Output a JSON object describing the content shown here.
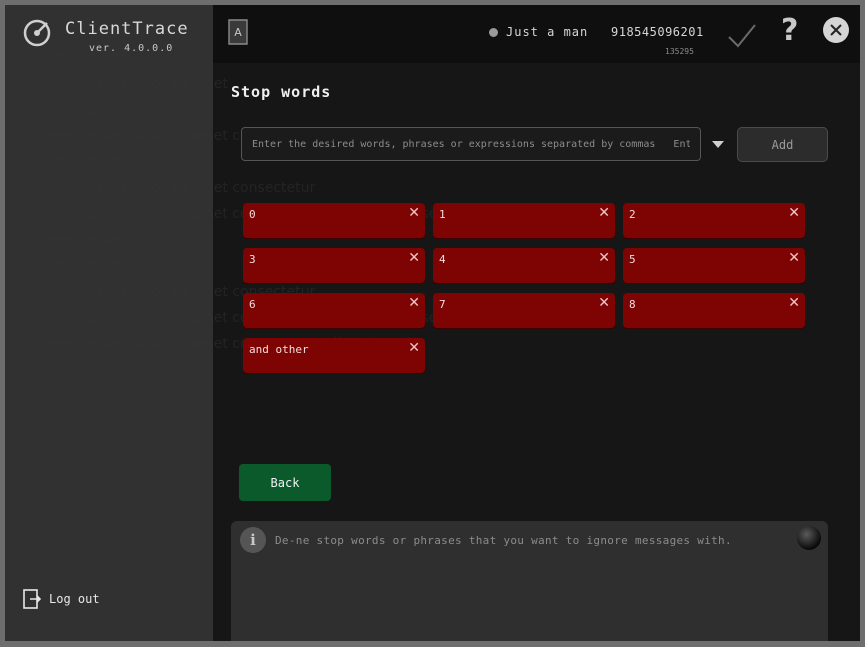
{
  "app": {
    "name": "ClientTrace",
    "version": "ver. 4.0.0.0"
  },
  "topbar": {
    "user": "Just a man",
    "phone": "918545096201",
    "phone_sub": "135295"
  },
  "page": {
    "title": "Stop words",
    "input_placeholder": "Enter the desired words, phrases or expressions separated by commas   Ent",
    "add_label": "Add",
    "back_label": "Back",
    "hint": "De-ne stop words or phrases that you want to ignore messages with."
  },
  "chips": [
    {
      "label": "0"
    },
    {
      "label": "1"
    },
    {
      "label": "2"
    },
    {
      "label": "3"
    },
    {
      "label": "4"
    },
    {
      "label": "5"
    },
    {
      "label": "6"
    },
    {
      "label": "7"
    },
    {
      "label": "8"
    },
    {
      "label": "and other"
    }
  ],
  "sidebar": {
    "logout_label": "Log out"
  },
  "icons": {
    "logo": "logo-icon",
    "document": "document-icon",
    "check": "check-icon",
    "help": "help-icon",
    "close": "close-icon",
    "dropdown": "chevron-down-icon",
    "info": "info-icon",
    "remove": "close-icon",
    "logout": "logout-icon"
  },
  "colors": {
    "chip": "#7e0303",
    "back_button": "#0b5a2c",
    "background": "#161616"
  }
}
